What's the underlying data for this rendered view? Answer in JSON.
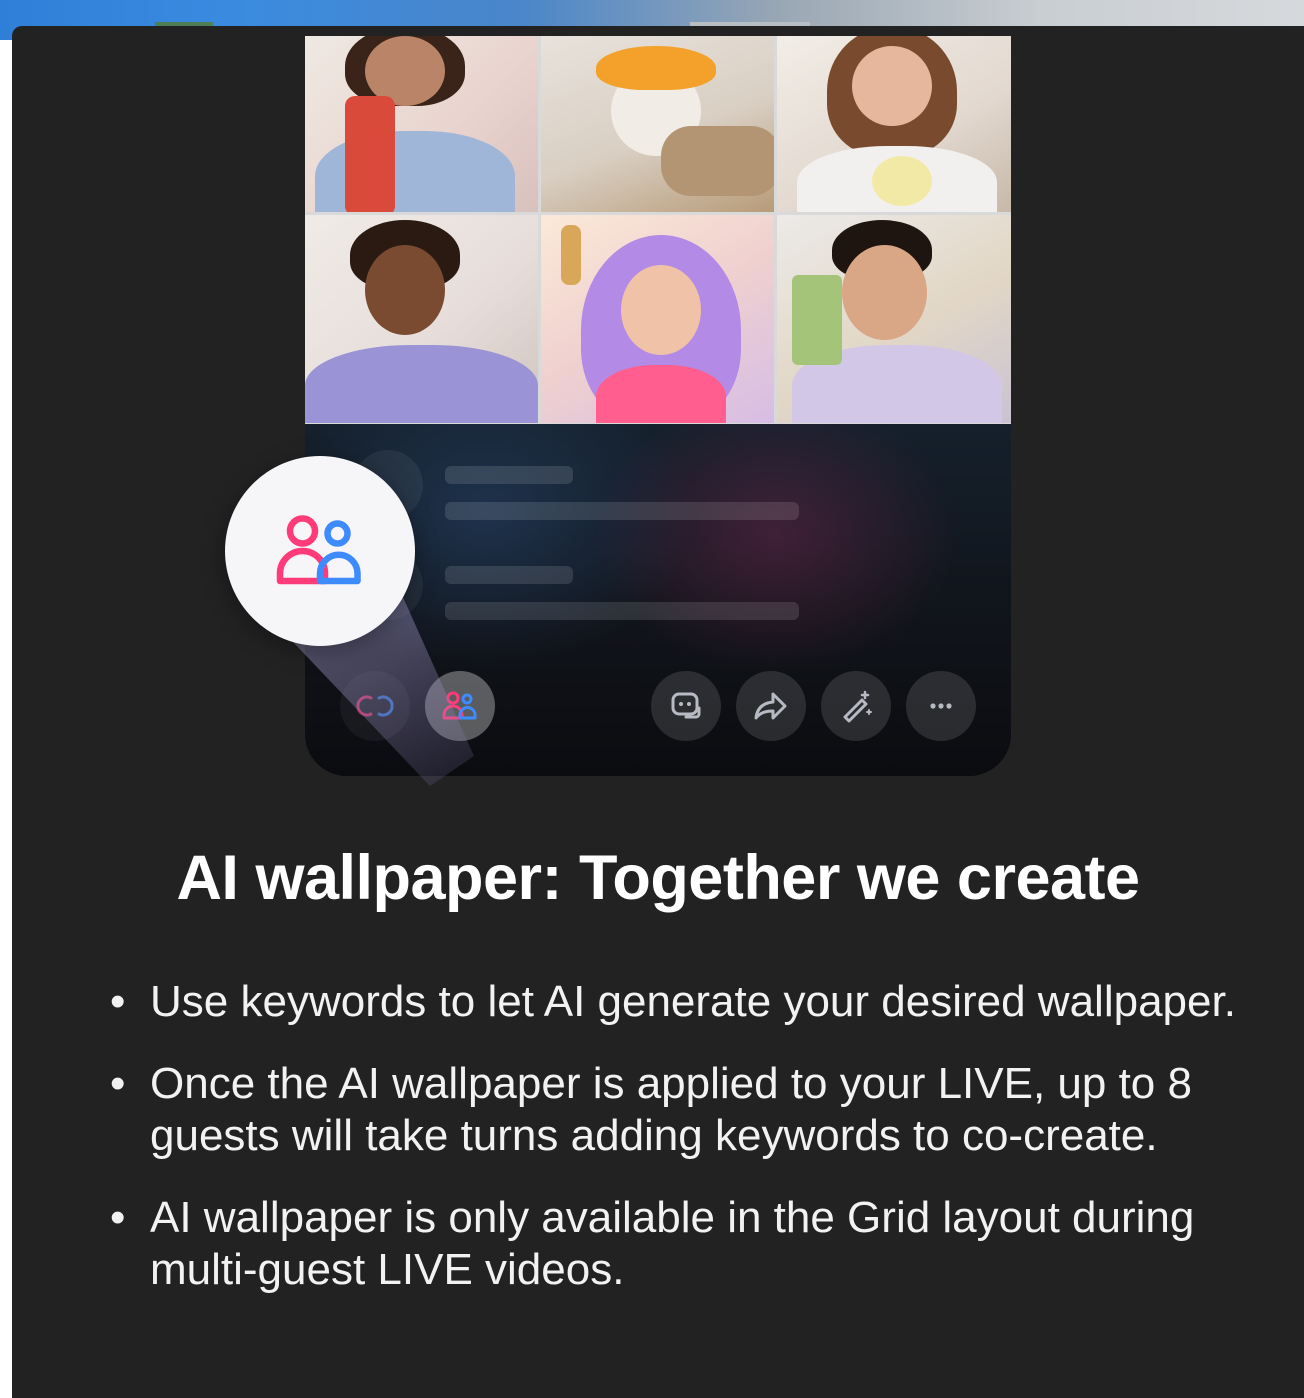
{
  "screen": {
    "backdrop_colors": [
      "#2f7fd8",
      "#c9ced2"
    ],
    "sheet_background": "#222222"
  },
  "preview": {
    "guest_tiles": [
      {
        "name": "guest-1",
        "tone": "#e8d2cc"
      },
      {
        "name": "guest-2",
        "tone": "#d8c9b7"
      },
      {
        "name": "guest-3",
        "tone": "#e4d9cf"
      },
      {
        "name": "guest-4",
        "tone": "#e8dfda"
      },
      {
        "name": "guest-5",
        "tone": "#e9d0dd"
      },
      {
        "name": "guest-6",
        "tone": "#e2dbd0"
      }
    ],
    "callout_icon": "multi-guest-icon",
    "toolbar": [
      {
        "icon": "link-icon"
      },
      {
        "icon": "multi-guest-icon"
      },
      {
        "icon": "comment-icon"
      },
      {
        "icon": "share-icon"
      },
      {
        "icon": "magic-wand-icon"
      },
      {
        "icon": "more-icon"
      }
    ],
    "accent_pink": "#ff3b7a",
    "accent_blue": "#3d8bff"
  },
  "content": {
    "title": "AI wallpaper: Together we create",
    "bullets": [
      "Use keywords to let AI generate your desired wallpaper.",
      "Once the AI wallpaper is applied to your LIVE, up to 8 guests will take turns adding keywords to co-create.",
      "AI wallpaper is only available in the Grid layout during multi-guest LIVE videos."
    ]
  }
}
